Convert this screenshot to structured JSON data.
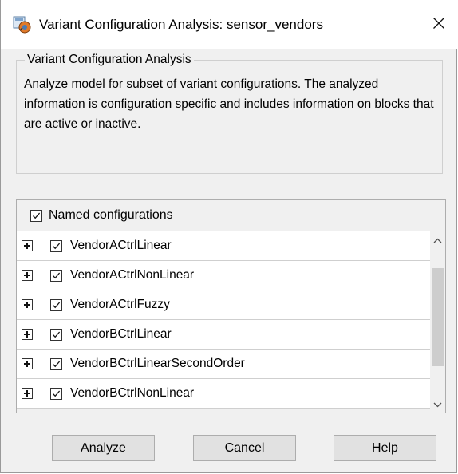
{
  "window": {
    "title": "Variant Configuration Analysis: sensor_vendors",
    "icon": "simulink-model-icon",
    "close_glyph": "✕"
  },
  "group": {
    "legend": "Variant Configuration Analysis",
    "description": "Analyze model for subset of variant configurations. The analyzed information is configuration specific and includes information on blocks that are active or inactive."
  },
  "configurations": {
    "header_label": "Named configurations",
    "header_checked": true,
    "items": [
      {
        "label": "VendorACtrlLinear",
        "checked": true
      },
      {
        "label": "VendorACtrlNonLinear",
        "checked": true
      },
      {
        "label": "VendorACtrlFuzzy",
        "checked": true
      },
      {
        "label": "VendorBCtrlLinear",
        "checked": true
      },
      {
        "label": "VendorBCtrlLinearSecondOrder",
        "checked": true
      },
      {
        "label": "VendorBCtrlNonLinear",
        "checked": true
      }
    ]
  },
  "buttons": {
    "analyze": "Analyze",
    "cancel": "Cancel",
    "help": "Help"
  }
}
